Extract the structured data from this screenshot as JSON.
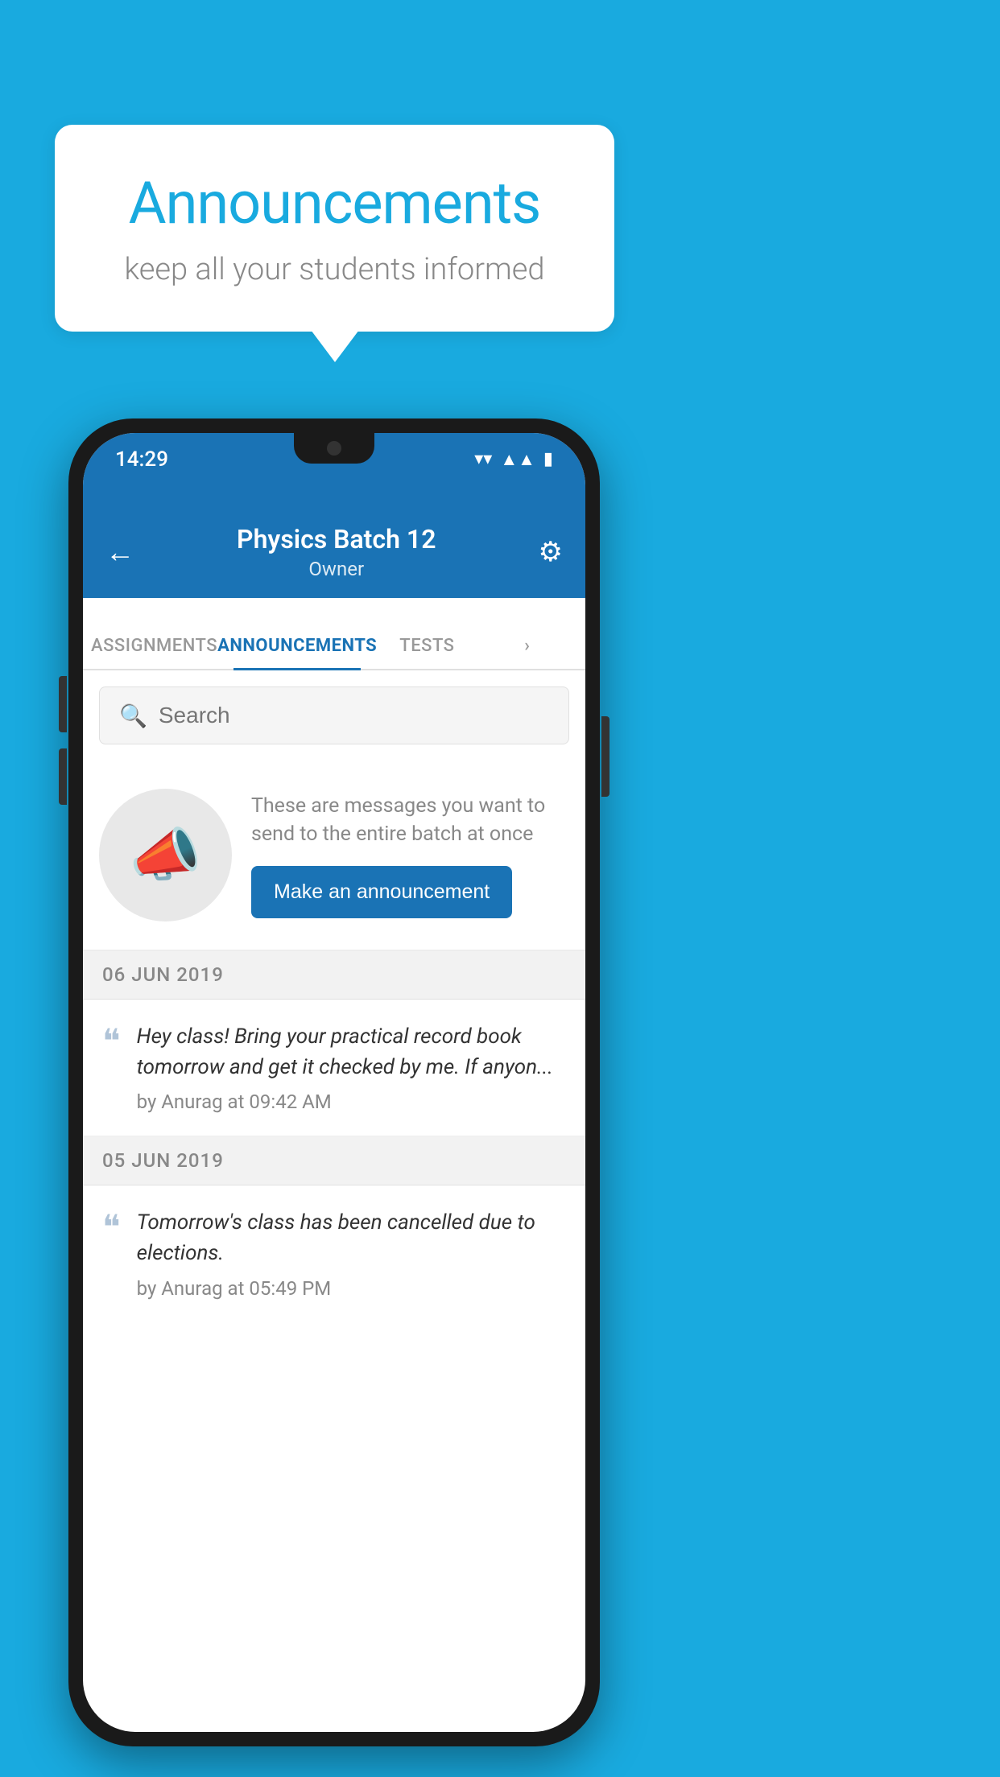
{
  "background_color": "#19AADF",
  "speech_bubble": {
    "title": "Announcements",
    "subtitle": "keep all your students informed"
  },
  "phone": {
    "status_bar": {
      "time": "14:29",
      "icons": [
        "wifi",
        "signal",
        "battery"
      ]
    },
    "header": {
      "back_label": "←",
      "title": "Physics Batch 12",
      "subtitle": "Owner",
      "gear_label": "⚙"
    },
    "tabs": [
      {
        "label": "ASSIGNMENTS",
        "active": false
      },
      {
        "label": "ANNOUNCEMENTS",
        "active": true
      },
      {
        "label": "TESTS",
        "active": false
      },
      {
        "label": "›",
        "active": false
      }
    ],
    "search": {
      "placeholder": "Search"
    },
    "empty_state": {
      "description": "These are messages you want to send to the entire batch at once",
      "button_label": "Make an announcement"
    },
    "announcements": [
      {
        "date": "06  JUN  2019",
        "message": "Hey class! Bring your practical record book tomorrow and get it checked by me. If anyon...",
        "author": "by Anurag at 09:42 AM"
      },
      {
        "date": "05  JUN  2019",
        "message": "Tomorrow's class has been cancelled due to elections.",
        "author": "by Anurag at 05:49 PM"
      }
    ]
  }
}
